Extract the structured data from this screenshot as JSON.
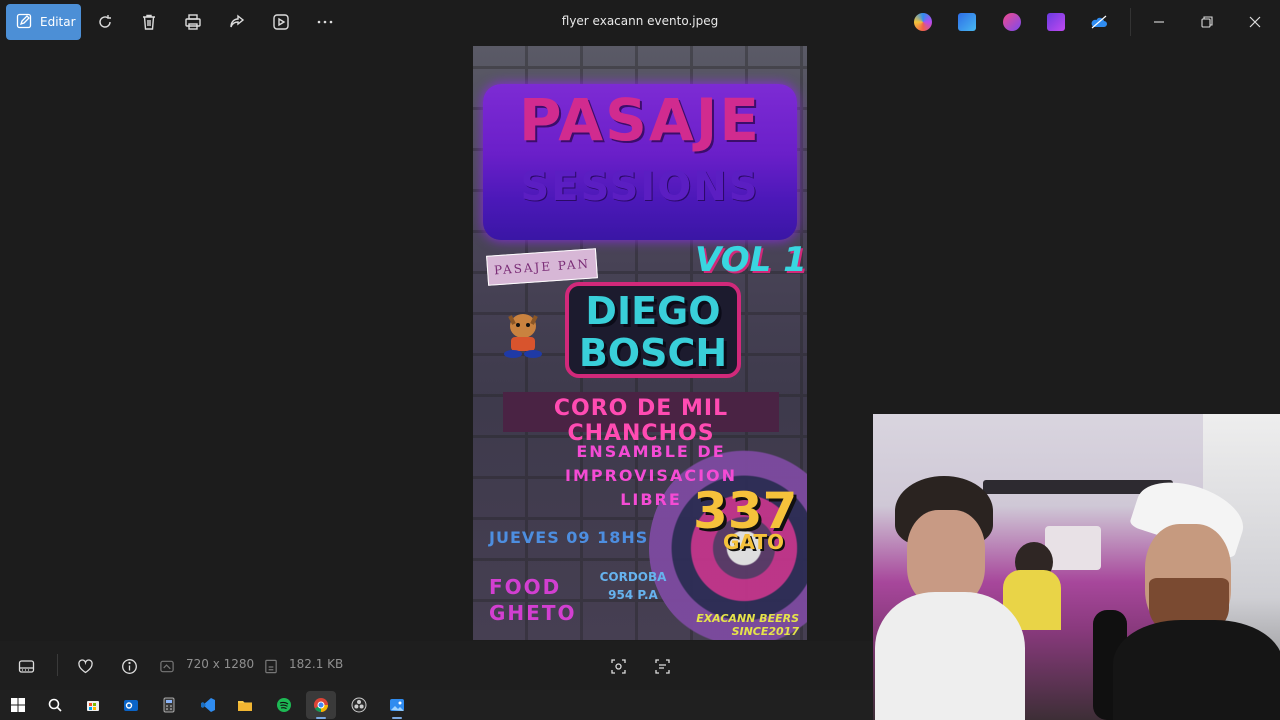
{
  "toolbar": {
    "edit_label": "Editar",
    "file_title": "flyer exacann evento.jpeg"
  },
  "icons": {
    "edit": "edit-image-icon",
    "rotate": "rotate-icon",
    "delete": "trash-icon",
    "print": "print-icon",
    "share": "share-icon",
    "slideshow": "slideshow-icon",
    "more": "more-icon",
    "copilot": "copilot-icon",
    "designer": "designer-icon",
    "paint": "paint-icon",
    "clipchamp": "clipchamp-icon",
    "onedrive": "onedrive-icon",
    "minimize": "minimize-icon",
    "maximize": "restore-icon",
    "close": "close-icon"
  },
  "flyer": {
    "title_line1": "PASAJE",
    "title_line2": "SESSIONS",
    "tag": "PASAJE PAN",
    "vol": "VOL 1",
    "artist_line1": "DIEGO",
    "artist_line2": "BOSCH",
    "coro": "CORO DE MIL CHANCHOS",
    "ensamble_line1": "ENSAMBLE DE",
    "ensamble_line2": "IMPROVISACION",
    "ensamble_line3": "LIBRE",
    "number": "337",
    "gato": "GATO",
    "date": "JUEVES 09 18HS",
    "ghetto_line1": "FOOD",
    "ghetto_line2": "GHETO",
    "address_line1": "CORDOBA",
    "address_line2": "954 P.A",
    "since": "EXACANN BEERS SINCE2017"
  },
  "status": {
    "dimensions": "720 x 1280",
    "size": "182.1 KB"
  },
  "colors": {
    "accent": "#4c8fd6",
    "background": "#1c1c1c",
    "taskbar": "#202020"
  }
}
